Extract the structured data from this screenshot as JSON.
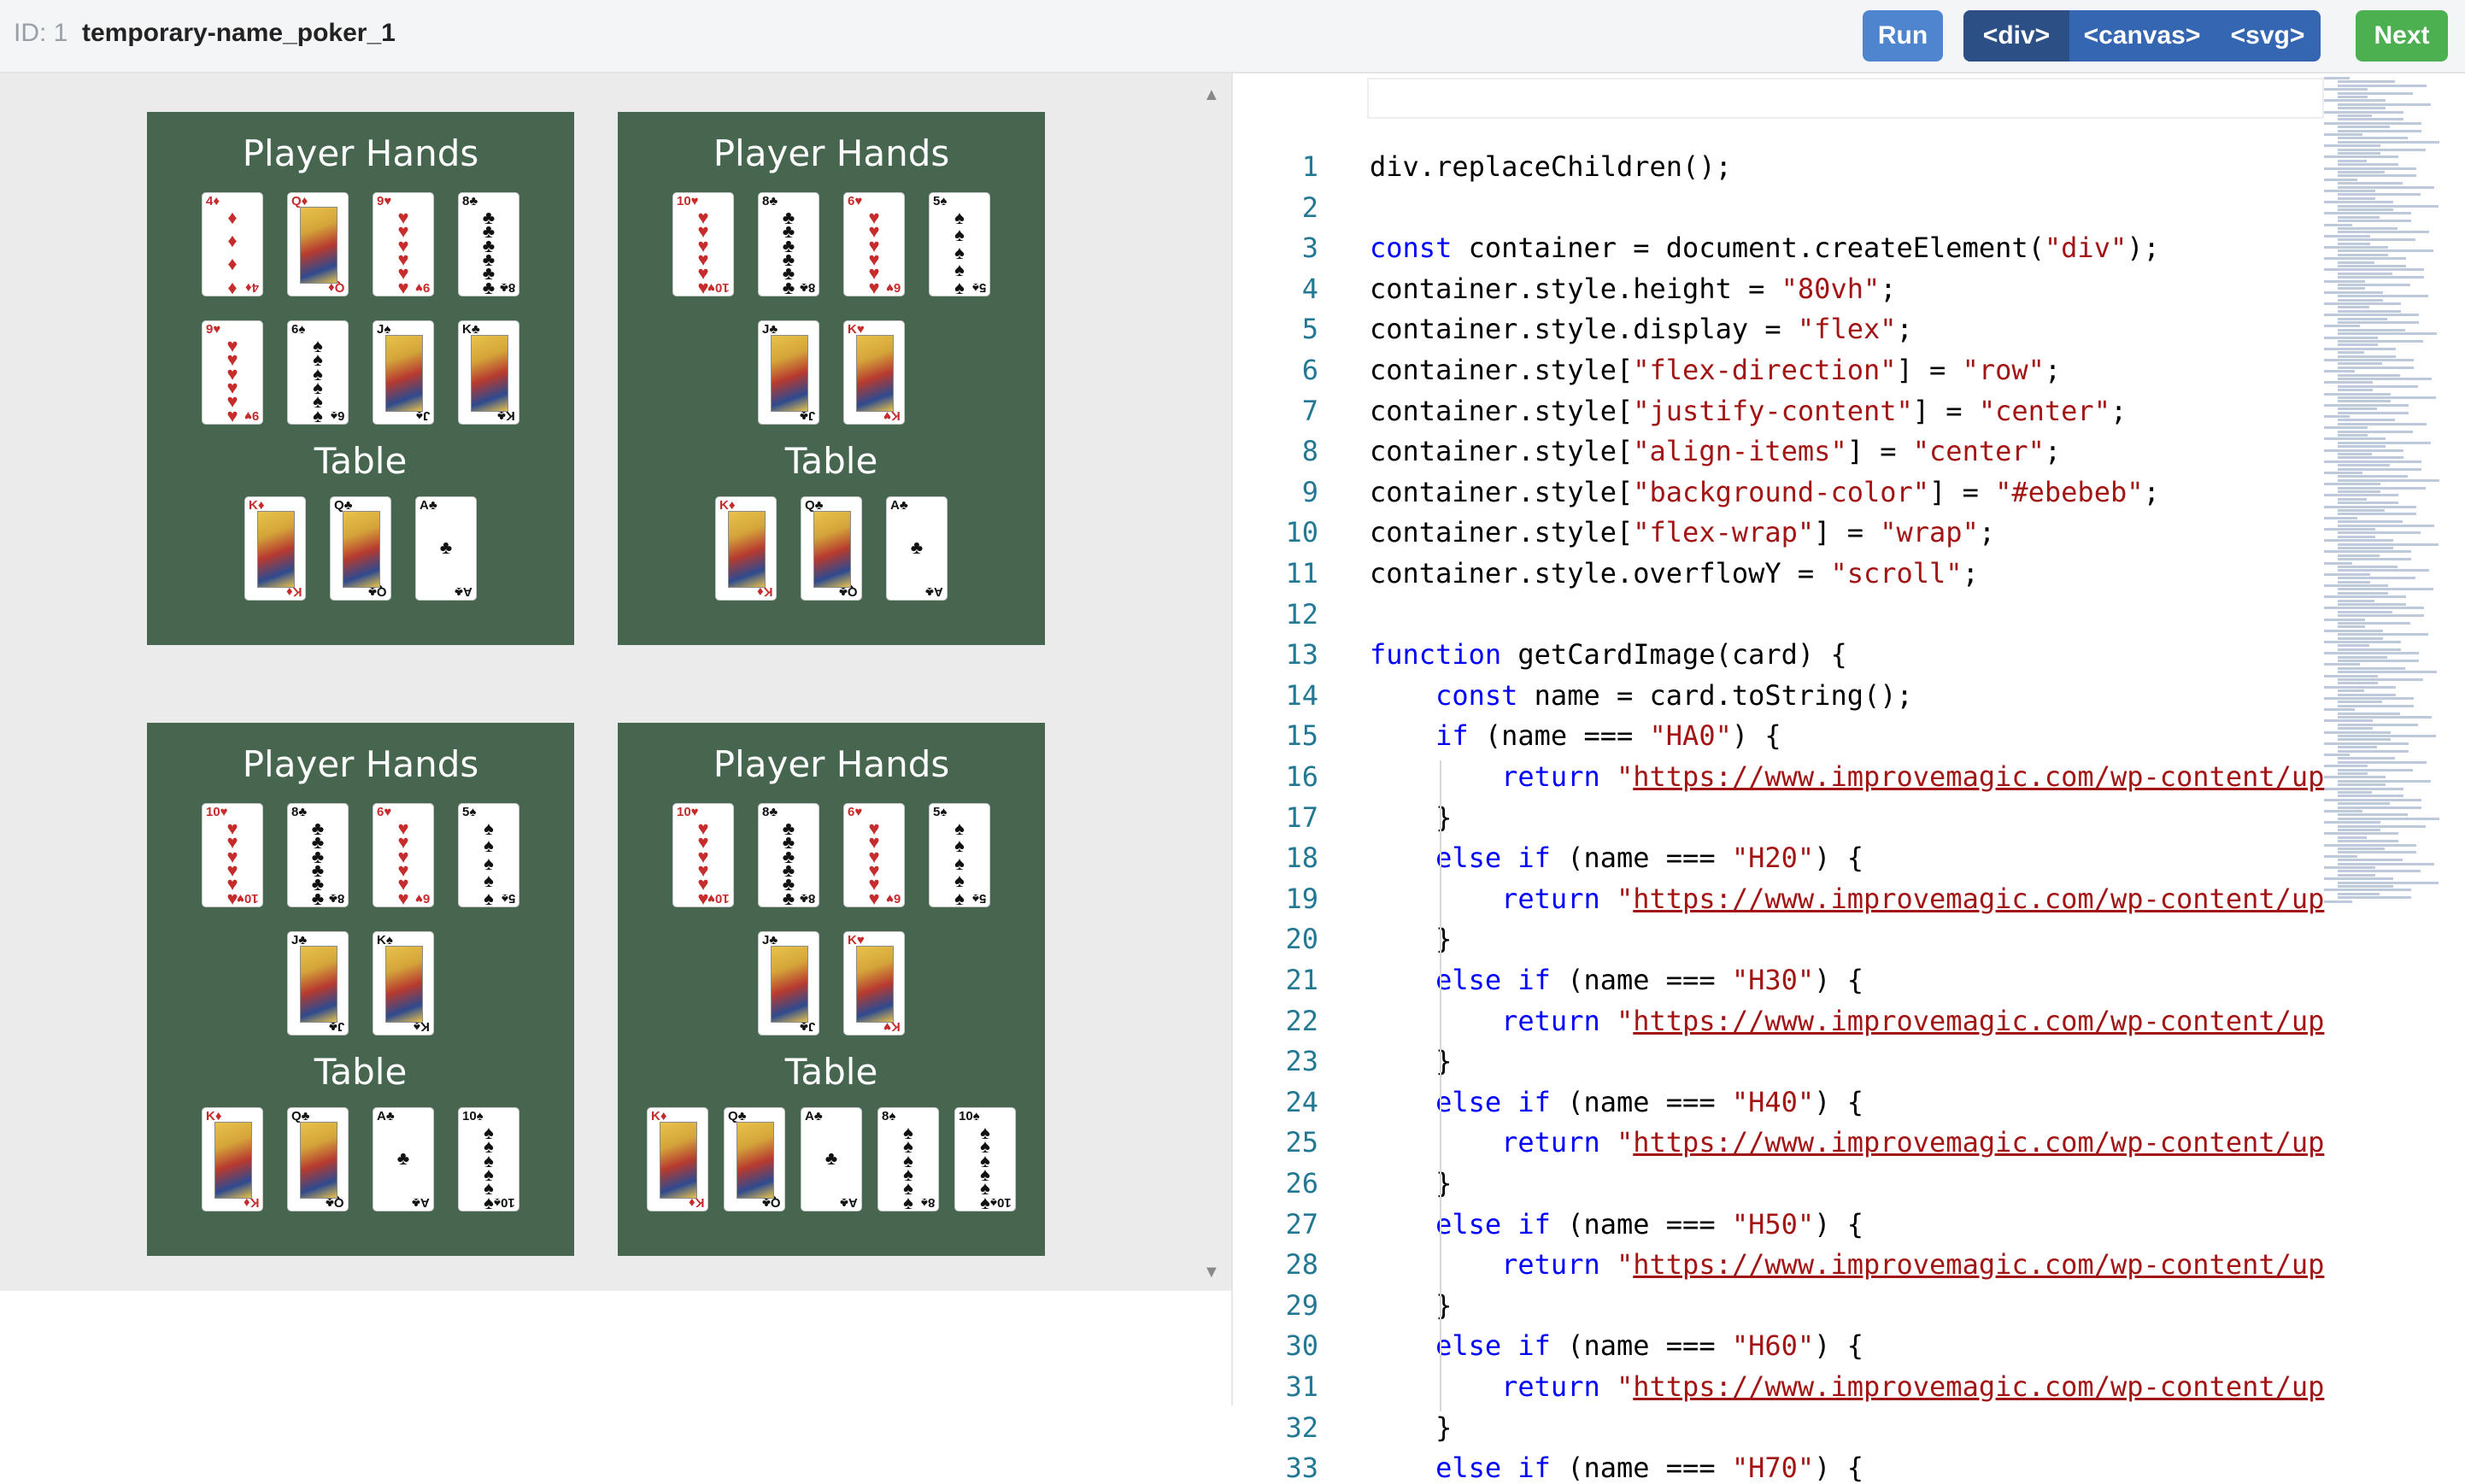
{
  "header": {
    "id_label": "ID: 1",
    "title": "temporary-name_poker_1",
    "run_label": "Run",
    "modes": [
      "<div>",
      "<canvas>",
      "<svg>"
    ],
    "next_label": "Next"
  },
  "preview": {
    "panels": [
      {
        "hands_title": "Player Hands",
        "table_title": "Table",
        "hand_rows": [
          [
            "4♦",
            "Q♦",
            "9♥",
            "8♣"
          ],
          [
            "9♥",
            "6♠",
            "J♠",
            "K♣"
          ]
        ],
        "table_cards": [
          "K♦",
          "Q♣",
          "A♣"
        ]
      },
      {
        "hands_title": "Player Hands",
        "table_title": "Table",
        "hand_rows": [
          [
            "10♥",
            "8♣",
            "6♥",
            "5♠"
          ],
          [
            "J♣",
            "K♥"
          ]
        ],
        "table_cards": [
          "K♦",
          "Q♣",
          "A♣"
        ]
      },
      {
        "hands_title": "Player Hands",
        "table_title": "Table",
        "hand_rows": [
          [
            "10♥",
            "8♣",
            "6♥",
            "5♠"
          ],
          [
            "J♣",
            "K♠"
          ]
        ],
        "table_cards": [
          "K♦",
          "Q♣",
          "A♣",
          "10♠"
        ]
      },
      {
        "hands_title": "Player Hands",
        "table_title": "Table",
        "hand_rows": [
          [
            "10♥",
            "8♣",
            "6♥",
            "5♠"
          ],
          [
            "J♣",
            "K♥"
          ]
        ],
        "table_cards": [
          "K♦",
          "Q♣",
          "A♣",
          "8♠",
          "10♠"
        ]
      }
    ]
  },
  "editor": {
    "lines": [
      "div.replaceChildren();",
      "",
      "const container = document.createElement(\"div\");",
      "container.style.height = \"80vh\";",
      "container.style.display = \"flex\";",
      "container.style[\"flex-direction\"] = \"row\";",
      "container.style[\"justify-content\"] = \"center\";",
      "container.style[\"align-items\"] = \"center\";",
      "container.style[\"background-color\"] = \"#ebebeb\";",
      "container.style[\"flex-wrap\"] = \"wrap\";",
      "container.style.overflowY = \"scroll\";",
      "",
      "function getCardImage(card) {",
      "    const name = card.toString();",
      "    if (name === \"HA0\") {",
      "        return \"https://www.improvemagic.com/wp-content/up",
      "    }",
      "    else if (name === \"H20\") {",
      "        return \"https://www.improvemagic.com/wp-content/up",
      "    }",
      "    else if (name === \"H30\") {",
      "        return \"https://www.improvemagic.com/wp-content/up",
      "    }",
      "    else if (name === \"H40\") {",
      "        return \"https://www.improvemagic.com/wp-content/up",
      "    }",
      "    else if (name === \"H50\") {",
      "        return \"https://www.improvemagic.com/wp-content/up",
      "    }",
      "    else if (name === \"H60\") {",
      "        return \"https://www.improvemagic.com/wp-content/up",
      "    }",
      "    else if (name === \"H70\") {"
    ]
  }
}
